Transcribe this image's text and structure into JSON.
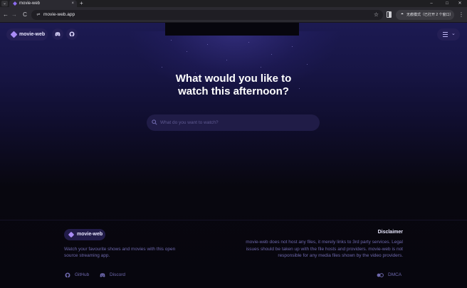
{
  "browser": {
    "tab_list_icon": "chevron-down-icon",
    "tab": {
      "title": "movie-web",
      "close": "×"
    },
    "new_tab": "+",
    "window_controls": {
      "minimize": "–",
      "maximize": "□",
      "close": "✕"
    },
    "nav": {
      "back": "←",
      "forward": "→",
      "reload": "C"
    },
    "url": "movie-web.app",
    "bookmark_star": "☆",
    "incognito_label": "无痕模式（已打开 2 个窗口）",
    "menu": "⋮"
  },
  "header": {
    "brand": "movie-web",
    "discord_icon": "discord-icon",
    "github_icon": "github-icon",
    "menu_chevron": "⌄"
  },
  "hero": {
    "title_line1": "What would you like to",
    "title_line2": "watch this afternoon?"
  },
  "search": {
    "placeholder": "What do you want to watch?"
  },
  "footer": {
    "brand": "movie-web",
    "tagline": "Watch your favourite shows and movies with this open source streaming app.",
    "links": {
      "github": "GitHub",
      "discord": "Discord"
    },
    "disclaimer_title": "Disclaimer",
    "disclaimer_text": "movie-web does not host any files, it merely links to 3rd party services. Legal issues should be taken up with the file hosts and providers. movie-web is not responsible for any media files shown by the video providers.",
    "dmca": "DMCA"
  },
  "colors": {
    "accent": "#a98cf5",
    "pill_bg": "#241f55",
    "muted_text": "#6e68ad",
    "page_top": "#1c1a52",
    "page_bottom": "#07060e"
  }
}
